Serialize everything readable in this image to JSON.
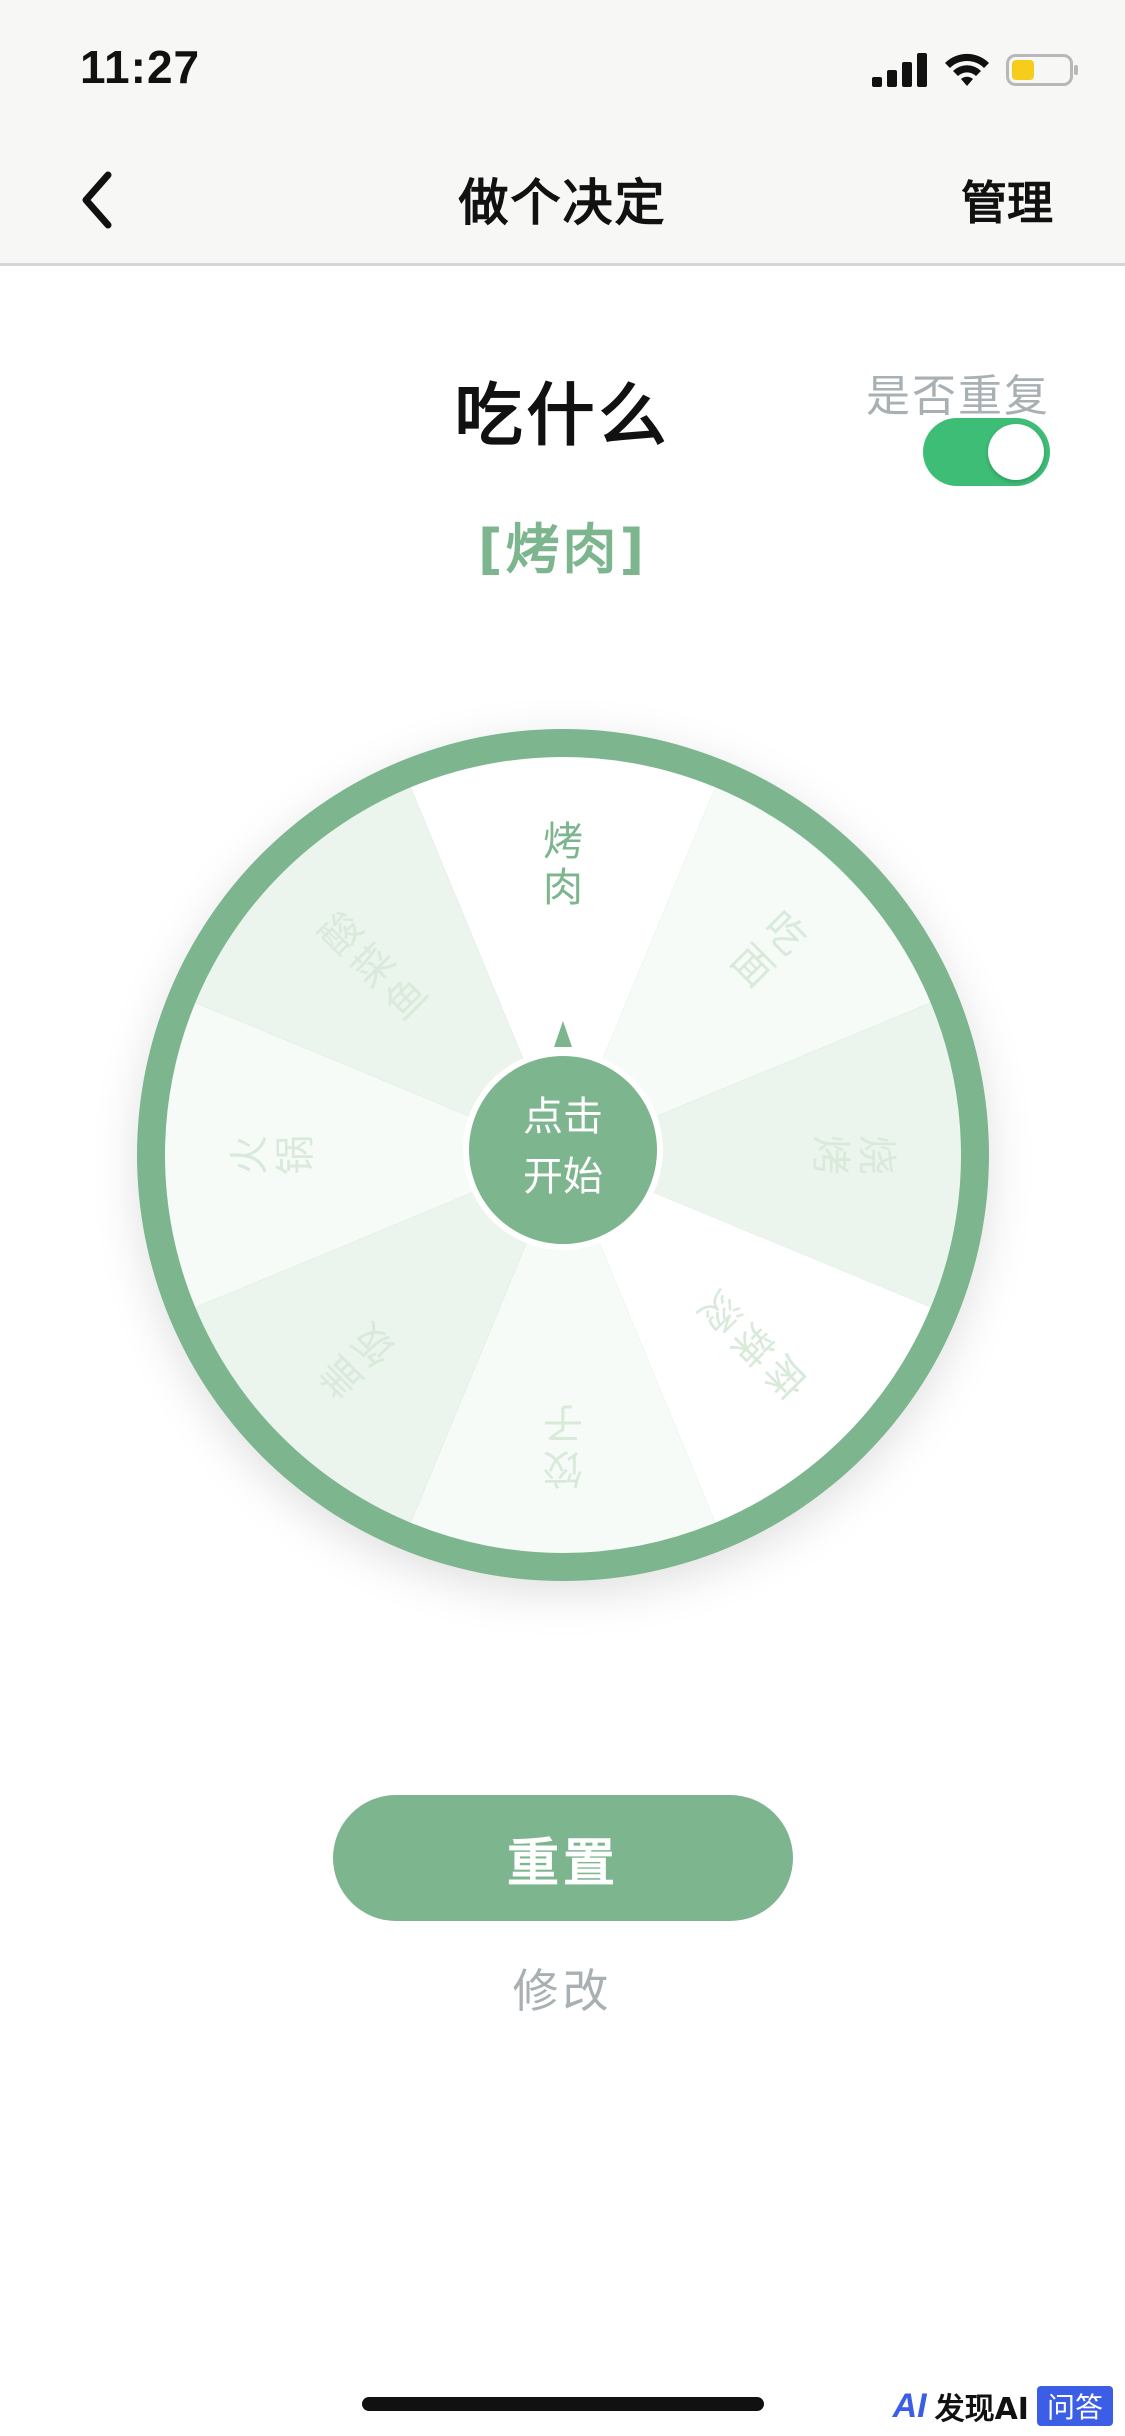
{
  "status": {
    "time": "11:27"
  },
  "nav": {
    "title": "做个决定",
    "manage_label": "管理"
  },
  "main": {
    "question": "吃什么",
    "repeat_label": "是否重复",
    "repeat_enabled": true,
    "result": "[烤肉]"
  },
  "wheel": {
    "start_label_line1": "点击",
    "start_label_line2": "开始",
    "segments": [
      {
        "label": "烤肉",
        "fill": "#ffffff",
        "text_color": "#7db58e"
      },
      {
        "label": "吃面",
        "fill": "#f6fbf7",
        "text_color": "#d9eadb"
      },
      {
        "label": "烧烤",
        "fill": "#ebf4ed",
        "text_color": "#d9eadb"
      },
      {
        "label": "麻辣烫",
        "fill": "#ffffff",
        "text_color": "#d9eadb"
      },
      {
        "label": "饺子",
        "fill": "#f6fbf7",
        "text_color": "#d9eadb"
      },
      {
        "label": "盖饭",
        "fill": "#ebf4ed",
        "text_color": "#d9eadb"
      },
      {
        "label": "火锅",
        "fill": "#f6fbf7",
        "text_color": "#d9eadb"
      },
      {
        "label": "酸菜鱼",
        "fill": "#ebf4ed",
        "text_color": "#d9eadb"
      }
    ],
    "ring_color": "#7db58e"
  },
  "actions": {
    "reset_label": "重置",
    "edit_label": "修改"
  },
  "watermark": {
    "logo": "AI",
    "text": "发现AI",
    "badge": "问答"
  }
}
